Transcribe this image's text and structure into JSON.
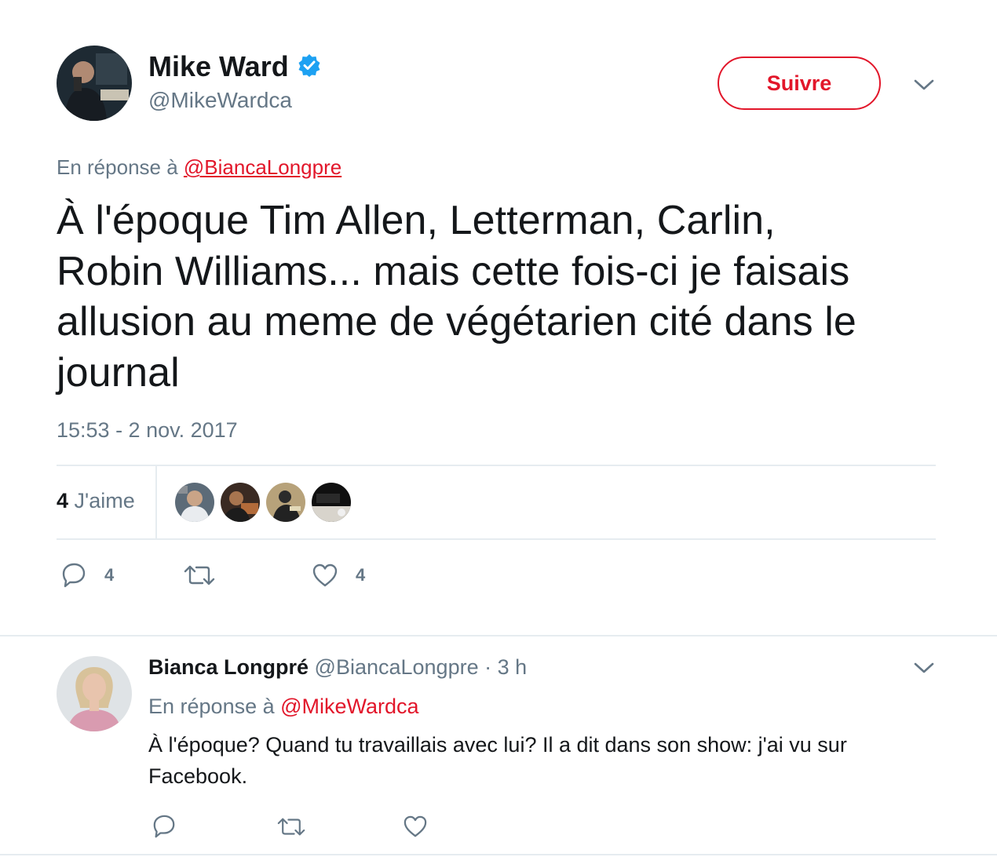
{
  "tweet": {
    "author_name": "Mike Ward",
    "author_handle": "@MikeWardca",
    "follow_label": "Suivre",
    "reply_prefix": "En réponse à",
    "reply_to": "@BiancaLongpre",
    "text_lines": [
      "À l'époque Tim Allen, Letterman, Carlin,",
      "Robin Williams... mais cette fois-ci je faisais",
      "allusion au meme de végétarien cité dans le",
      "journal"
    ],
    "timestamp": "15:53 - 2 nov. 2017",
    "likes_count": "4",
    "likes_label": "J'aime",
    "actions": {
      "reply_count": "4",
      "retweet_count": "",
      "like_count": "4"
    }
  },
  "reply": {
    "author_name": "Bianca Longpré",
    "author_handle": "@BiancaLongpre",
    "time": "· 3 h",
    "reply_prefix": "En réponse à",
    "reply_to": "@MikeWardca",
    "text_lines": [
      "À l'époque? Quand tu travaillais avec lui? Il a dit dans son show: j'ai vu sur",
      "Facebook."
    ]
  },
  "colors": {
    "accent": "#e2162a",
    "muted": "#657786",
    "verified": "#1da1f2",
    "divider": "#e6ecf0"
  },
  "icons": [
    "verified-badge-icon",
    "chevron-down-icon",
    "reply-icon",
    "retweet-icon",
    "heart-icon"
  ]
}
